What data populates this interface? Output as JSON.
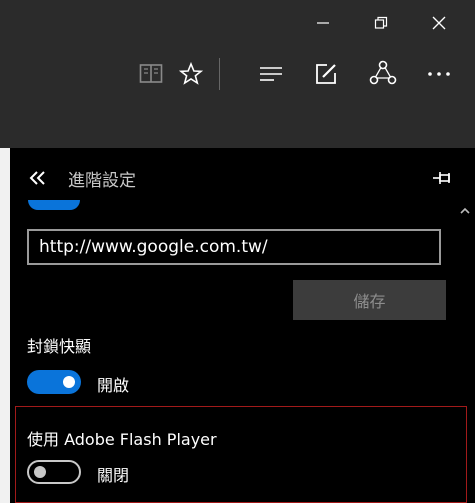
{
  "window": {
    "minimize_icon": "minimize-icon",
    "restore_icon": "restore-icon",
    "close_icon": "close-icon"
  },
  "toolbar": {
    "icons": [
      "reading-view-icon",
      "favorite-star-icon",
      "hub-icon",
      "web-note-icon",
      "share-icon",
      "more-icon"
    ]
  },
  "panel": {
    "back_icon": "double-chevron-left-icon",
    "title": "進階設定",
    "pin_icon": "pin-icon",
    "url_value": "http://www.google.com.tw/",
    "save_label": "儲存",
    "popup": {
      "label": "封鎖快顯",
      "state": "開啟",
      "on": true
    },
    "flash": {
      "label": "使用 Adobe Flash Player",
      "state": "關閉",
      "on": false
    }
  },
  "colors": {
    "accent": "#0a74da",
    "highlight": "#a21a1a",
    "chrome": "#2b2b2b",
    "panel": "#000000"
  }
}
